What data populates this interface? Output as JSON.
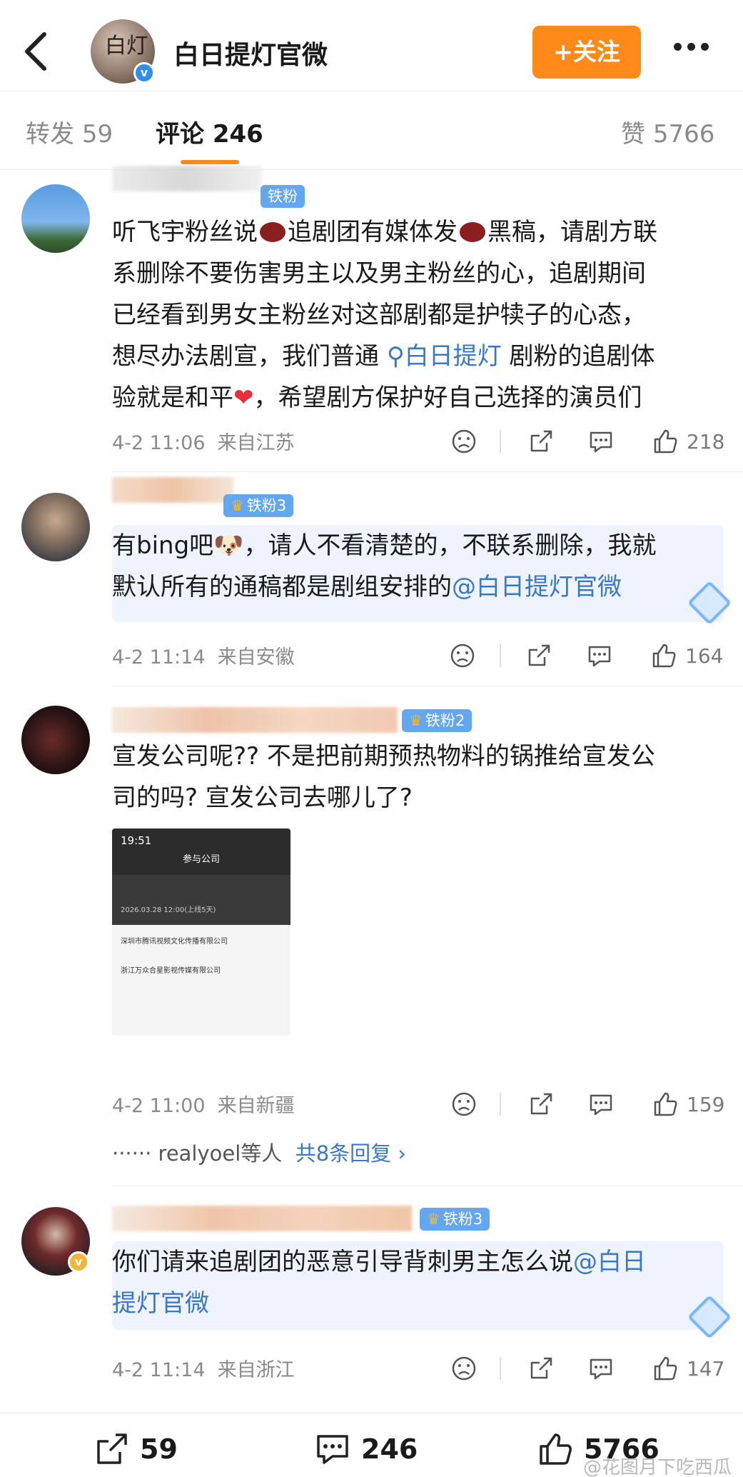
{
  "header": {
    "title": "白日提灯官微",
    "follow_label": "+关注",
    "avatar_glyph": "白灯"
  },
  "tabs": {
    "repost_label": "转发",
    "repost_count": "59",
    "comment_label": "评论",
    "comment_count": "246",
    "like_label": "赞",
    "like_count": "5766"
  },
  "comments": [
    {
      "badge": "铁粉",
      "lines": [
        "听飞宇粉丝说",
        "追剧团有媒体发",
        "黑稿，请剧方联",
        "系删除不要伤害男主以及男主粉丝的心，追剧期间",
        "已经看到男女主粉丝对这部剧都是护犊子的心态，",
        "想尽办法剧宣，我们普通",
        "白日提灯",
        "剧粉的追剧体",
        "验就是和平",
        "，希望剧方保护好自己选择的演员们"
      ],
      "date": "4-2 11:06",
      "location": "来自江苏",
      "likes": "218"
    },
    {
      "badge": "铁粉3",
      "lines": [
        "有bing吧",
        "，请人不看清楚的，不联系删除，我就",
        "默认所有的通稿都是剧组安排的",
        "@白日提灯官微"
      ],
      "date": "4-2 11:14",
      "location": "来自安徽",
      "likes": "164"
    },
    {
      "badge": "铁粉2",
      "lines": [
        "宣发公司呢?? 不是把前期预热物料的锅推给宣发公",
        "司的吗? 宣发公司去哪儿了?"
      ],
      "screenshot": {
        "time": "19:51",
        "title": "参与公司",
        "date": "2026.03.28 12:00(上线5天)",
        "company1": "深圳市腾讯视频文化传播有限公司",
        "company2": "浙江万众合星影视传媒有限公司"
      },
      "date": "4-2 11:00",
      "location": "来自新疆",
      "likes": "159",
      "replies_prefix": "······ realyoel等人",
      "replies_link": "共8条回复 ›"
    },
    {
      "badge": "铁粉3",
      "lines": [
        "你们请来追剧团的恶意引导背刺男主怎么说",
        "@白日",
        "提灯官微"
      ],
      "date": "4-2 11:14",
      "location": "来自浙江",
      "likes": "147"
    }
  ],
  "bottom": {
    "repost": "59",
    "comment": "246",
    "like": "5766"
  },
  "watermark": "@花图月下吃西瓜",
  "colors": {
    "accent": "#ff8a1a",
    "link": "#3a78c3",
    "badge": "#63a7f0"
  }
}
